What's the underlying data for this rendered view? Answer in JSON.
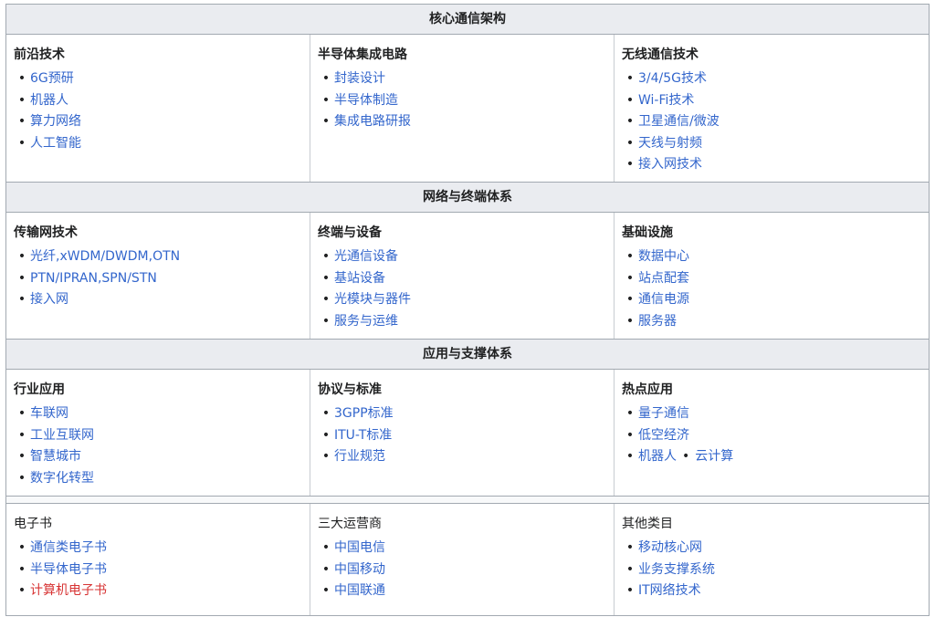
{
  "sections": [
    {
      "header": "核心通信架构",
      "cells": [
        {
          "title": "前沿技术",
          "items": [
            "6G预研",
            "机器人",
            "算力网络",
            "人工智能"
          ]
        },
        {
          "title": "半导体集成电路",
          "items": [
            "封装设计",
            "半导体制造",
            "集成电路研报"
          ]
        },
        {
          "title": "无线通信技术",
          "items": [
            "3/4/5G技术",
            "Wi-Fi技术",
            "卫星通信/微波",
            "天线与射频",
            "接入网技术"
          ]
        }
      ]
    },
    {
      "header": "网络与终端体系",
      "cells": [
        {
          "title": "传输网技术",
          "items": [
            "光纤,xWDM/DWDM,OTN",
            "PTN/IPRAN,SPN/STN",
            "接入网"
          ]
        },
        {
          "title": "终端与设备",
          "items": [
            "光通信设备",
            "基站设备",
            "光模块与器件",
            "服务与运维"
          ]
        },
        {
          "title": "基础设施",
          "items": [
            "数据中心",
            "站点配套",
            "通信电源",
            "服务器"
          ]
        }
      ]
    },
    {
      "header": "应用与支撑体系",
      "cells": [
        {
          "title": "行业应用",
          "items": [
            "车联网",
            "工业互联网",
            "智慧城市",
            "数字化转型"
          ]
        },
        {
          "title": "协议与标准",
          "items": [
            "3GPP标准",
            "ITU-T标准",
            "行业规范"
          ]
        },
        {
          "title": "热点应用",
          "items": [
            "量子通信",
            "低空经济"
          ],
          "pair": [
            "机器人",
            "云计算"
          ]
        }
      ]
    }
  ],
  "footer": {
    "cells": [
      {
        "title": "电子书",
        "items": [
          "通信类电子书",
          "半导体电子书",
          "计算机电子书"
        ]
      },
      {
        "title": "三大运营商",
        "items": [
          "中国电信",
          "中国移动",
          "中国联通"
        ]
      },
      {
        "title": "其他类目",
        "items": [
          "移动核心网",
          "业务支撑系统",
          "IT网络技术"
        ]
      }
    ]
  },
  "bullet": "•",
  "colors": {
    "link": "#3366cc",
    "red_link": "#d73333",
    "header_bg": "#eaecf0",
    "border": "#a2a9b1"
  }
}
